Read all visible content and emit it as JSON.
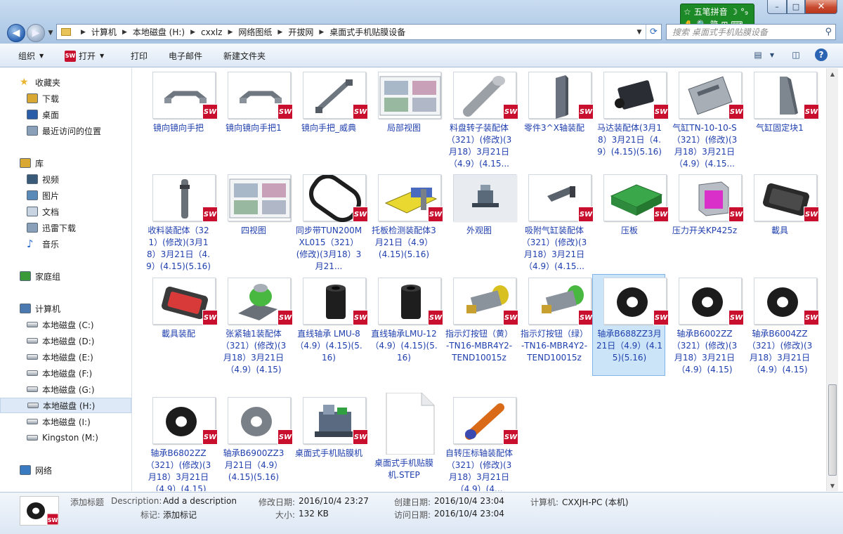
{
  "window": {
    "min_glyph": "–",
    "max_glyph": "□",
    "close_glyph": "✕"
  },
  "ime": {
    "row1": "☆ 五笔拼音  ☽ °₉",
    "row2": "✋ 🔍 简 ⊞ ⌨"
  },
  "address": {
    "breadcrumbs": [
      "计算机",
      "本地磁盘 (H:)",
      "cxxlz",
      "网络图纸",
      "开拔网",
      "桌面式手机贴膜设备"
    ],
    "separator": "▶"
  },
  "search": {
    "placeholder": "搜索 桌面式手机贴膜设备"
  },
  "toolbar": {
    "organize": "组织",
    "open": "打开",
    "print": "打印",
    "email": "电子邮件",
    "new_folder": "新建文件夹",
    "help": "?"
  },
  "nav": {
    "favorites": {
      "label": "收藏夹",
      "items": [
        "下载",
        "桌面",
        "最近访问的位置"
      ]
    },
    "libraries": {
      "label": "库",
      "items": [
        "视频",
        "图片",
        "文档",
        "迅雷下载",
        "音乐"
      ]
    },
    "homegroup": "家庭组",
    "computer": {
      "label": "计算机",
      "drives": [
        "本地磁盘 (C:)",
        "本地磁盘 (D:)",
        "本地磁盘 (E:)",
        "本地磁盘 (F:)",
        "本地磁盘 (G:)",
        "本地磁盘 (H:)",
        "本地磁盘 (I:)",
        "Kingston (M:)"
      ]
    },
    "network": "网络"
  },
  "files": [
    {
      "name": "镜向镜向手把",
      "icon": "handle-part",
      "badge": true
    },
    {
      "name": "镜向镜向手把1",
      "icon": "handle-part",
      "badge": true
    },
    {
      "name": "镜向手把_威典",
      "icon": "handle-bar",
      "badge": true
    },
    {
      "name": "局部视图",
      "icon": "drawing-sheet",
      "badge": false
    },
    {
      "name": "料盘转子装配体（321）(修改)(3月18）3月21日（4.9）(4.15...",
      "icon": "rotor-shaft",
      "badge": true
    },
    {
      "name": "零件3^X轴装配",
      "icon": "plate",
      "badge": true
    },
    {
      "name": "马达装配体(3月18）3月21日（4.9）(4.15)(5.16)",
      "icon": "motor",
      "badge": true
    },
    {
      "name": "气缸TN-10-10-S（321）(修改)(3月18）3月21日（4.9）(4.15...",
      "icon": "cylinder",
      "badge": true
    },
    {
      "name": "气缸固定块1",
      "icon": "bracket",
      "badge": true
    },
    {
      "name": "收料装配体（321）(修改)(3月18）3月21日（4.9）(4.15)(5.16)",
      "icon": "rod",
      "badge": true
    },
    {
      "name": "四视图",
      "icon": "drawing-sheet",
      "badge": false
    },
    {
      "name": "同步带TUN200MXL015（321）(修改)(3月18）3月21...",
      "icon": "belt",
      "badge": true
    },
    {
      "name": "托板检测装配体3月21日（4.9）(4.15)(5.16)",
      "icon": "tray",
      "badge": true
    },
    {
      "name": "外观图",
      "icon": "machine-view",
      "badge": false
    },
    {
      "name": "吸附气缸装配体（321）(修改)(3月18）3月21日（4.9）(4.15...",
      "icon": "suction",
      "badge": true
    },
    {
      "name": "压板",
      "icon": "press-plate",
      "badge": true
    },
    {
      "name": "压力开关KP425z",
      "icon": "switch-box",
      "badge": true
    },
    {
      "name": "載具",
      "icon": "carrier",
      "badge": true
    },
    {
      "name": "載具装配",
      "icon": "carrier-red",
      "badge": true
    },
    {
      "name": "张紧轴1装配体（321）(修改)(3月18）3月21日（4.9）(4.15)(5...",
      "icon": "tension",
      "badge": true
    },
    {
      "name": "直线轴承 LMU-8（4.9）(4.15)(5.16)",
      "icon": "bushing",
      "badge": true
    },
    {
      "name": "直线轴承LMU-12（4.9）(4.15)(5.16)",
      "icon": "bushing",
      "badge": true
    },
    {
      "name": "指示灯按钮（黄）-TN16-MBR4Y2-TEND10015z",
      "icon": "lamp-yellow",
      "badge": true
    },
    {
      "name": "指示灯按钮（绿）-TN16-MBR4Y2-TEND10015z",
      "icon": "lamp-green",
      "badge": true
    },
    {
      "name": "轴承B688ZZ3月21日（4.9）(4.15)(5.16)",
      "icon": "bearing",
      "badge": true,
      "selected": true
    },
    {
      "name": "轴承B6002ZZ（321）(修改)(3月18）3月21日（4.9）(4.15)(5...",
      "icon": "bearing",
      "badge": true
    },
    {
      "name": "轴承B6004ZZ（321）(修改)(3月18）3月21日（4.9）(4.15)(5...",
      "icon": "bearing",
      "badge": true
    },
    {
      "name": "轴承B6802ZZ（321）(修改)(3月18）3月21日（4.9）(4.15)(5...",
      "icon": "bearing",
      "badge": true
    },
    {
      "name": "轴承B6900ZZ3月21日（4.9）(4.15)(5.16)",
      "icon": "bearing-grey",
      "badge": true
    },
    {
      "name": "桌面式手机贴膜机",
      "icon": "machine",
      "badge": true
    },
    {
      "name": "桌面式手机贴膜机.STEP",
      "icon": "blank-document",
      "badge": false
    },
    {
      "name": "自转压标轴装配体（321）(修改)(3月18）3月21日（4.9）(4...",
      "icon": "orange-shaft",
      "badge": true
    }
  ],
  "details": {
    "add_title": "添加标题",
    "description_label": "Description:",
    "description_value": "Add a description",
    "tag_label": "标记:",
    "tag_value": "添加标记",
    "modified_label": "修改日期:",
    "modified_value": "2016/10/4 23:27",
    "size_label": "大小:",
    "size_value": "132 KB",
    "created_label": "创建日期:",
    "created_value": "2016/10/4 23:04",
    "accessed_label": "访问日期:",
    "accessed_value": "2016/10/4 23:04",
    "computer_label": "计算机:",
    "computer_value": "CXXJH-PC (本机)"
  },
  "colors": {
    "link": "#1f3fae",
    "badge": "#c8102e",
    "selection": "#cce4f7"
  }
}
